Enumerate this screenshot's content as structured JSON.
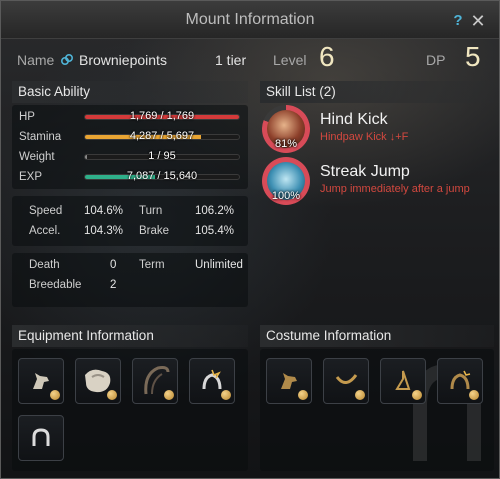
{
  "window": {
    "title": "Mount Information"
  },
  "icons": {
    "help": "help-icon",
    "close": "close-icon"
  },
  "header": {
    "name_label": "Name",
    "mount_name": "Browniepoints",
    "tier": "1 tier",
    "level_label": "Level",
    "level": "6",
    "dp_label": "DP",
    "dp": "5"
  },
  "basic": {
    "title": "Basic Ability",
    "bars": [
      {
        "label": "HP",
        "value": "1,769 / 1,769",
        "fraction": 1.0,
        "color": "#d43a3a"
      },
      {
        "label": "Stamina",
        "value": "4,287 / 5,697",
        "fraction": 0.753,
        "color": "#e9a533"
      },
      {
        "label": "Weight",
        "value": "1 / 95",
        "fraction": 0.01,
        "color": "#8a8a8a"
      },
      {
        "label": "EXP",
        "value": "7,087 / 15,640",
        "fraction": 0.453,
        "color": "#2fb08a"
      }
    ],
    "stats": [
      {
        "label": "Speed",
        "value": "104.6%"
      },
      {
        "label": "Turn",
        "value": "106.2%"
      },
      {
        "label": "Accel.",
        "value": "104.3%"
      },
      {
        "label": "Brake",
        "value": "105.4%"
      }
    ],
    "death_label": "Death",
    "death": "0",
    "term_label": "Term",
    "term": "Unlimited",
    "breedable_label": "Breedable",
    "breedable": "2"
  },
  "skills": {
    "title": "Skill List (2)",
    "items": [
      {
        "name": "Hind Kick",
        "desc": "Hindpaw Kick ↓+F",
        "percent": "81%",
        "fraction": 0.81
      },
      {
        "name": "Streak Jump",
        "desc": "Jump immediately after a jump",
        "percent": "100%",
        "fraction": 1.0
      }
    ]
  },
  "equipment": {
    "title": "Equipment Information",
    "slots": [
      "horse-head-icon",
      "saddle-icon",
      "stirrups-icon",
      "horseshoe-spark-icon",
      "horseshoe-icon"
    ]
  },
  "costume": {
    "title": "Costume Information",
    "slots": [
      "horse-head-icon",
      "saddle-icon",
      "stirrups-icon",
      "horseshoe-spark-icon"
    ]
  },
  "colors": {
    "accent_gold": "#f0e6c0",
    "skill_desc": "#d2483f",
    "ring": "#d84b58"
  }
}
